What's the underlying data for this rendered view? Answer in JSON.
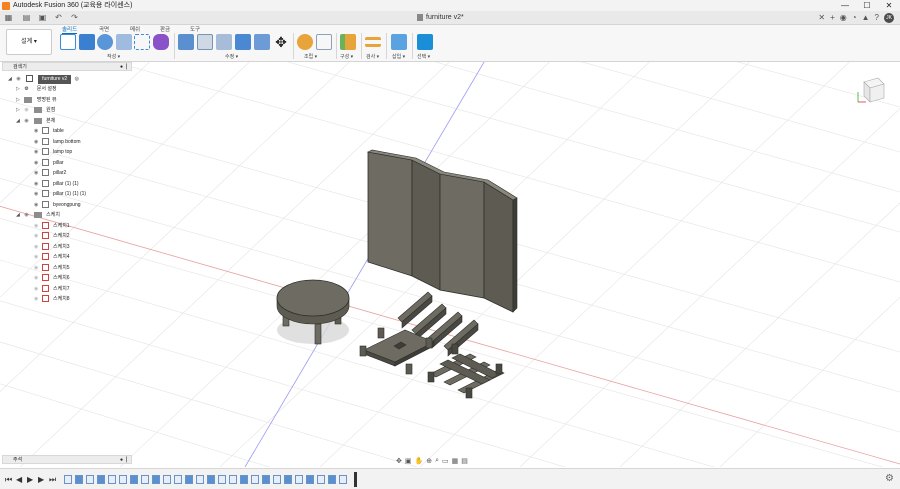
{
  "window": {
    "title": "Autodesk Fusion 360 (교육용 라이센스)",
    "minimize": "—",
    "maximize": "☐",
    "close": "✕"
  },
  "document": {
    "tab_title": "furniture v2*",
    "close": "✕"
  },
  "ribbon": {
    "workspace": "설계",
    "tabs": [
      "솔리드",
      "곡면",
      "메쉬",
      "판금",
      "도구"
    ],
    "groups": [
      "작성",
      "수정",
      "조립",
      "구성",
      "검사",
      "삽입",
      "선택"
    ]
  },
  "browser": {
    "header": "검색기",
    "root": "furniture v2",
    "items": [
      {
        "label": "문서 설정",
        "type": "settings"
      },
      {
        "label": "명명된 뷰",
        "type": "folder"
      },
      {
        "label": "원점",
        "type": "folder"
      },
      {
        "label": "본체",
        "type": "folder"
      },
      {
        "label": "table",
        "type": "body"
      },
      {
        "label": "lamp bottom",
        "type": "body"
      },
      {
        "label": "lamp top",
        "type": "body"
      },
      {
        "label": "pillar",
        "type": "body"
      },
      {
        "label": "pillar2",
        "type": "body"
      },
      {
        "label": "pillar (1) (1)",
        "type": "body"
      },
      {
        "label": "pillar (1) (1) (1)",
        "type": "body"
      },
      {
        "label": "byeongpung",
        "type": "body"
      },
      {
        "label": "스케치",
        "type": "folder"
      },
      {
        "label": "스케치1",
        "type": "sketch"
      },
      {
        "label": "스케치2",
        "type": "sketch"
      },
      {
        "label": "스케치3",
        "type": "sketch"
      },
      {
        "label": "스케치4",
        "type": "sketch"
      },
      {
        "label": "스케치5",
        "type": "sketch"
      },
      {
        "label": "스케치6",
        "type": "sketch"
      },
      {
        "label": "스케치7",
        "type": "sketch"
      },
      {
        "label": "스케치8",
        "type": "sketch"
      }
    ]
  },
  "comments": {
    "label": "주석"
  },
  "icons": {
    "grid": "grid-icon",
    "save": "save-icon",
    "undo": "undo-icon",
    "redo": "redo-icon",
    "orbit": "orbit-icon",
    "settings": "gear-icon"
  },
  "colors": {
    "accent": "#0a6fc2",
    "screen_face": "#6e6c62",
    "x_axis": "#e8a0a0",
    "y_axis": "#9a9aee"
  }
}
